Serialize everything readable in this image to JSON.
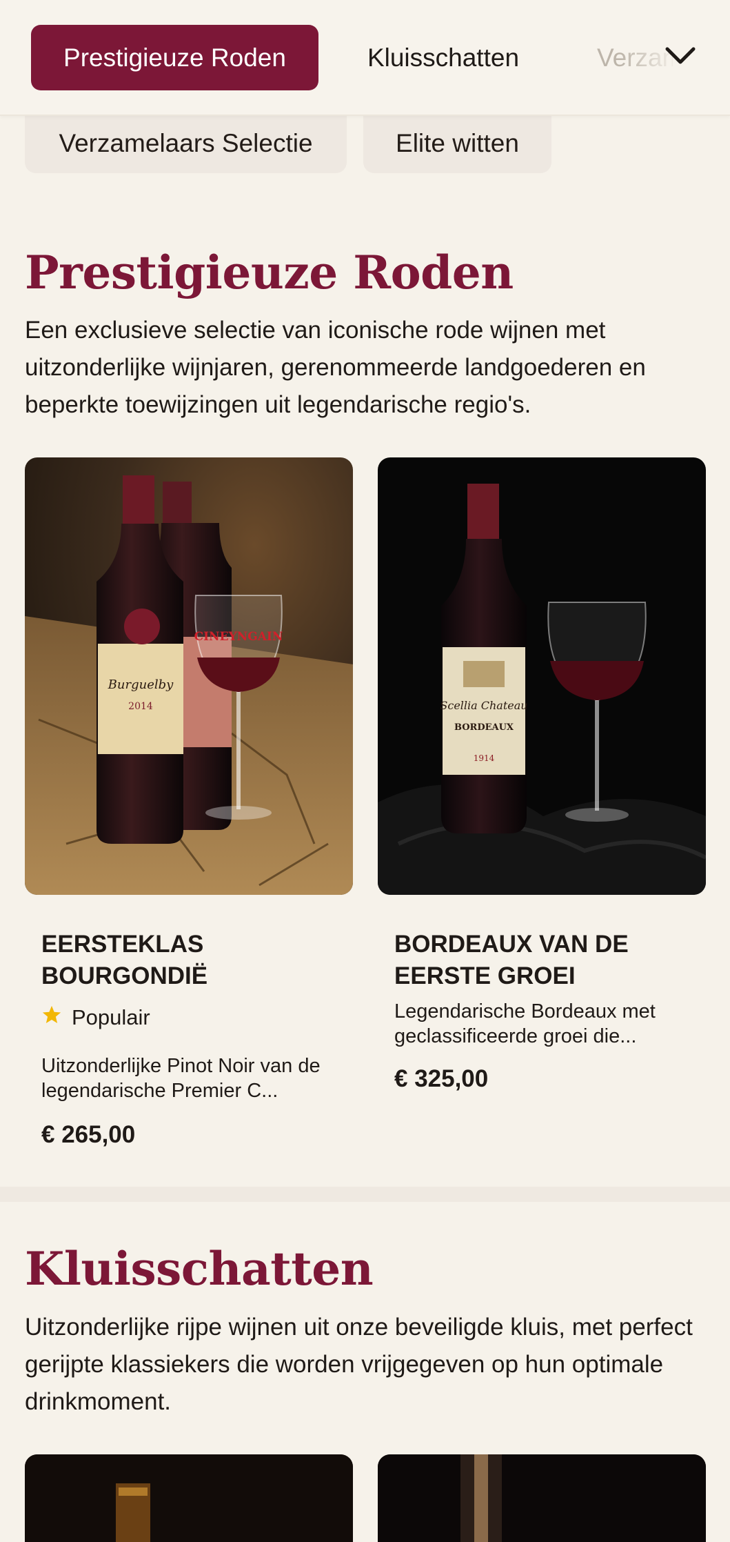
{
  "nav": {
    "tabs": [
      {
        "label": "Prestigieuze Roden",
        "active": true
      },
      {
        "label": "Kluisschatten"
      },
      {
        "label": "Verzamelaars Selectie"
      }
    ],
    "chips": [
      {
        "label": "Verzamelaars Selectie"
      },
      {
        "label": "Elite witten"
      }
    ],
    "expand_icon": "chevron-down-icon"
  },
  "sections": [
    {
      "title": "Prestigieuze Roden",
      "description": "Een exclusieve selectie van iconische rode wijnen met uitzonderlijke wijnjaren, gerenommeerde landgoederen en beperkte toewijzingen uit legendarische regio's.",
      "products": [
        {
          "name": "EERSTEKLAS BOURGONDIË",
          "badge": "Populair",
          "badge_icon": "star-icon",
          "description": "Uitzonderlijke Pinot Noir van de legendarische Premier C...",
          "price": "€ 265,00",
          "label_text": {
            "estate": "Burguelby",
            "year": "2014",
            "glass": "CINEYNGAIN"
          }
        },
        {
          "name": "BORDEAUX VAN DE EERSTE GROEI",
          "description": "Legendarische Bordeaux met geclassificeerde groei die...",
          "price": "€ 325,00",
          "label_text": {
            "estate": "Scellia Chateau",
            "region": "BORDEAUX",
            "year": "1914"
          }
        }
      ]
    },
    {
      "title": "Kluisschatten",
      "description": "Uitzonderlijke rijpe wijnen uit onze beveiligde kluis, met perfect gerijpte klassiekers die worden vrijgegeven op hun optimale drinkmoment."
    }
  ],
  "colors": {
    "accent": "#7c1737",
    "background": "#f6f2ea",
    "chip": "#eee8e1",
    "star": "#f2b705"
  }
}
